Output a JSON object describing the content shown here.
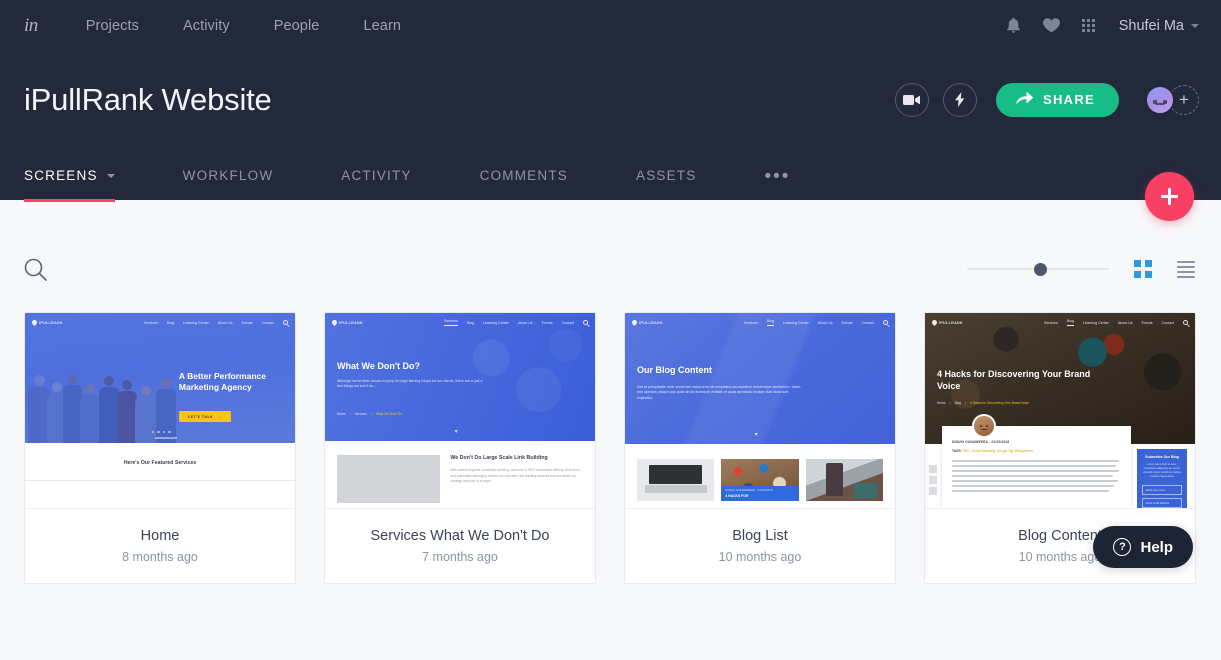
{
  "topnav": {
    "logo": "in",
    "links": [
      {
        "label": "Projects"
      },
      {
        "label": "Activity"
      },
      {
        "label": "People"
      },
      {
        "label": "Learn"
      }
    ],
    "icons": {
      "bell": "bell-icon",
      "heart": "heart-icon",
      "apps": "apps-grid-icon"
    },
    "user": "Shufei Ma"
  },
  "project": {
    "title": "iPullRank Website",
    "actions": {
      "video": "video-camera-icon",
      "bolt": "lightning-bolt-icon",
      "share_label": "SHARE",
      "share_icon": "share-arrow-icon",
      "add_member": "+"
    }
  },
  "tabs": [
    {
      "label": "SCREENS",
      "active": true,
      "has_caret": true
    },
    {
      "label": "WORKFLOW",
      "active": false,
      "has_caret": false
    },
    {
      "label": "ACTIVITY",
      "active": false,
      "has_caret": false
    },
    {
      "label": "COMMENTS",
      "active": false,
      "has_caret": false
    },
    {
      "label": "ASSETS",
      "active": false,
      "has_caret": false
    }
  ],
  "tab_more": "•••",
  "fab": {
    "label": "+",
    "name": "add-screen-button"
  },
  "toolbar": {
    "search_icon": "search-icon",
    "zoom_value": 50,
    "view_grid": "grid-view-icon",
    "view_list": "list-view-icon"
  },
  "screens": [
    {
      "name": "Home",
      "time": "8 months ago",
      "site": {
        "logo": "IPULLRANK",
        "menu": [
          "Services",
          "Blog",
          "Learning Center",
          "About Us",
          "Events",
          "Contact"
        ],
        "active_menu": "",
        "heading": "A Better Performance Marketing Agency",
        "sub": "",
        "cta": "LET'S TALK",
        "section_title": "Here's Our Featured Services"
      }
    },
    {
      "name": "Services What We Don't Do",
      "time": "7 months ago",
      "site": {
        "logo": "IPULLRANK",
        "menu": [
          "Services",
          "Blog",
          "Learning Center",
          "About Us",
          "Events",
          "Contact"
        ],
        "active_menu": "Services",
        "heading": "What We Don't Do?",
        "sub": "Although we've been known to jump through flaming hoops for our clients, there are a just a few things we won't do...",
        "crumbs": [
          "Home",
          "Services",
          "What We Don't Do"
        ],
        "section_title": "We Don't Do Large Scale Link Building",
        "section_body": "With search engines constantly evolving, and tons of SEO companies offering short-term, and potentially damaging results, we only offer link building services that are driven by strategy and part of a larger."
      }
    },
    {
      "name": "Blog List",
      "time": "10 months ago",
      "site": {
        "logo": "IPULLRANK",
        "menu": [
          "Services",
          "Blog",
          "Learning Center",
          "About Us",
          "Events",
          "Contact"
        ],
        "active_menu": "Blog",
        "heading": "Our Blog Content",
        "sub": "Sed ut perspiciatis unde omnis iste natus error sit voluptatem accusantium doloremque laudantium, totam rem aperiam, eaque ipsa quae ab illo inventore veritatis et quasi architecto beatae vitae dicta sunt explicabo.",
        "post_meta": "DINUKI GUNAWEERA - 01/20/2016",
        "post_title": "4 HACKS FOR"
      }
    },
    {
      "name": "Blog Content",
      "time": "10 months ago",
      "site": {
        "logo": "IPULLRANK",
        "menu": [
          "Services",
          "Blog",
          "Learning Center",
          "About Us",
          "Events",
          "Contact"
        ],
        "active_menu": "Blog",
        "heading": "4 Hacks for Discovering Your Brand Voice",
        "crumbs": [
          "Home",
          "Blog",
          "4 Hacks for Discovering Your Brand Voice"
        ],
        "byline": "DINUKI GUNAWEERA - 01/20/2016",
        "tags_label": "TAGS:",
        "tags": "SEO, Online Marketing, Google Tag Management",
        "sidebar_title": "Subscribe Our Blog",
        "sidebar_body": "Lorem ipsum dolor sit amet, consectetur adipiscing elit, sed do eiusmod tempor incididunt ut labore et dolore magna aliqua.",
        "field_name": "Enter your name",
        "field_email": "Enter email address"
      }
    }
  ],
  "help": {
    "label": "Help",
    "icon": "question-circle-icon"
  },
  "colors": {
    "nav_bg": "#22293a",
    "page_bg": "#f7f8fa",
    "accent_pink": "#f74063",
    "share_green": "#17bc86",
    "grid_blue": "#2f9ae0",
    "site_blue": "#3b63d6"
  }
}
